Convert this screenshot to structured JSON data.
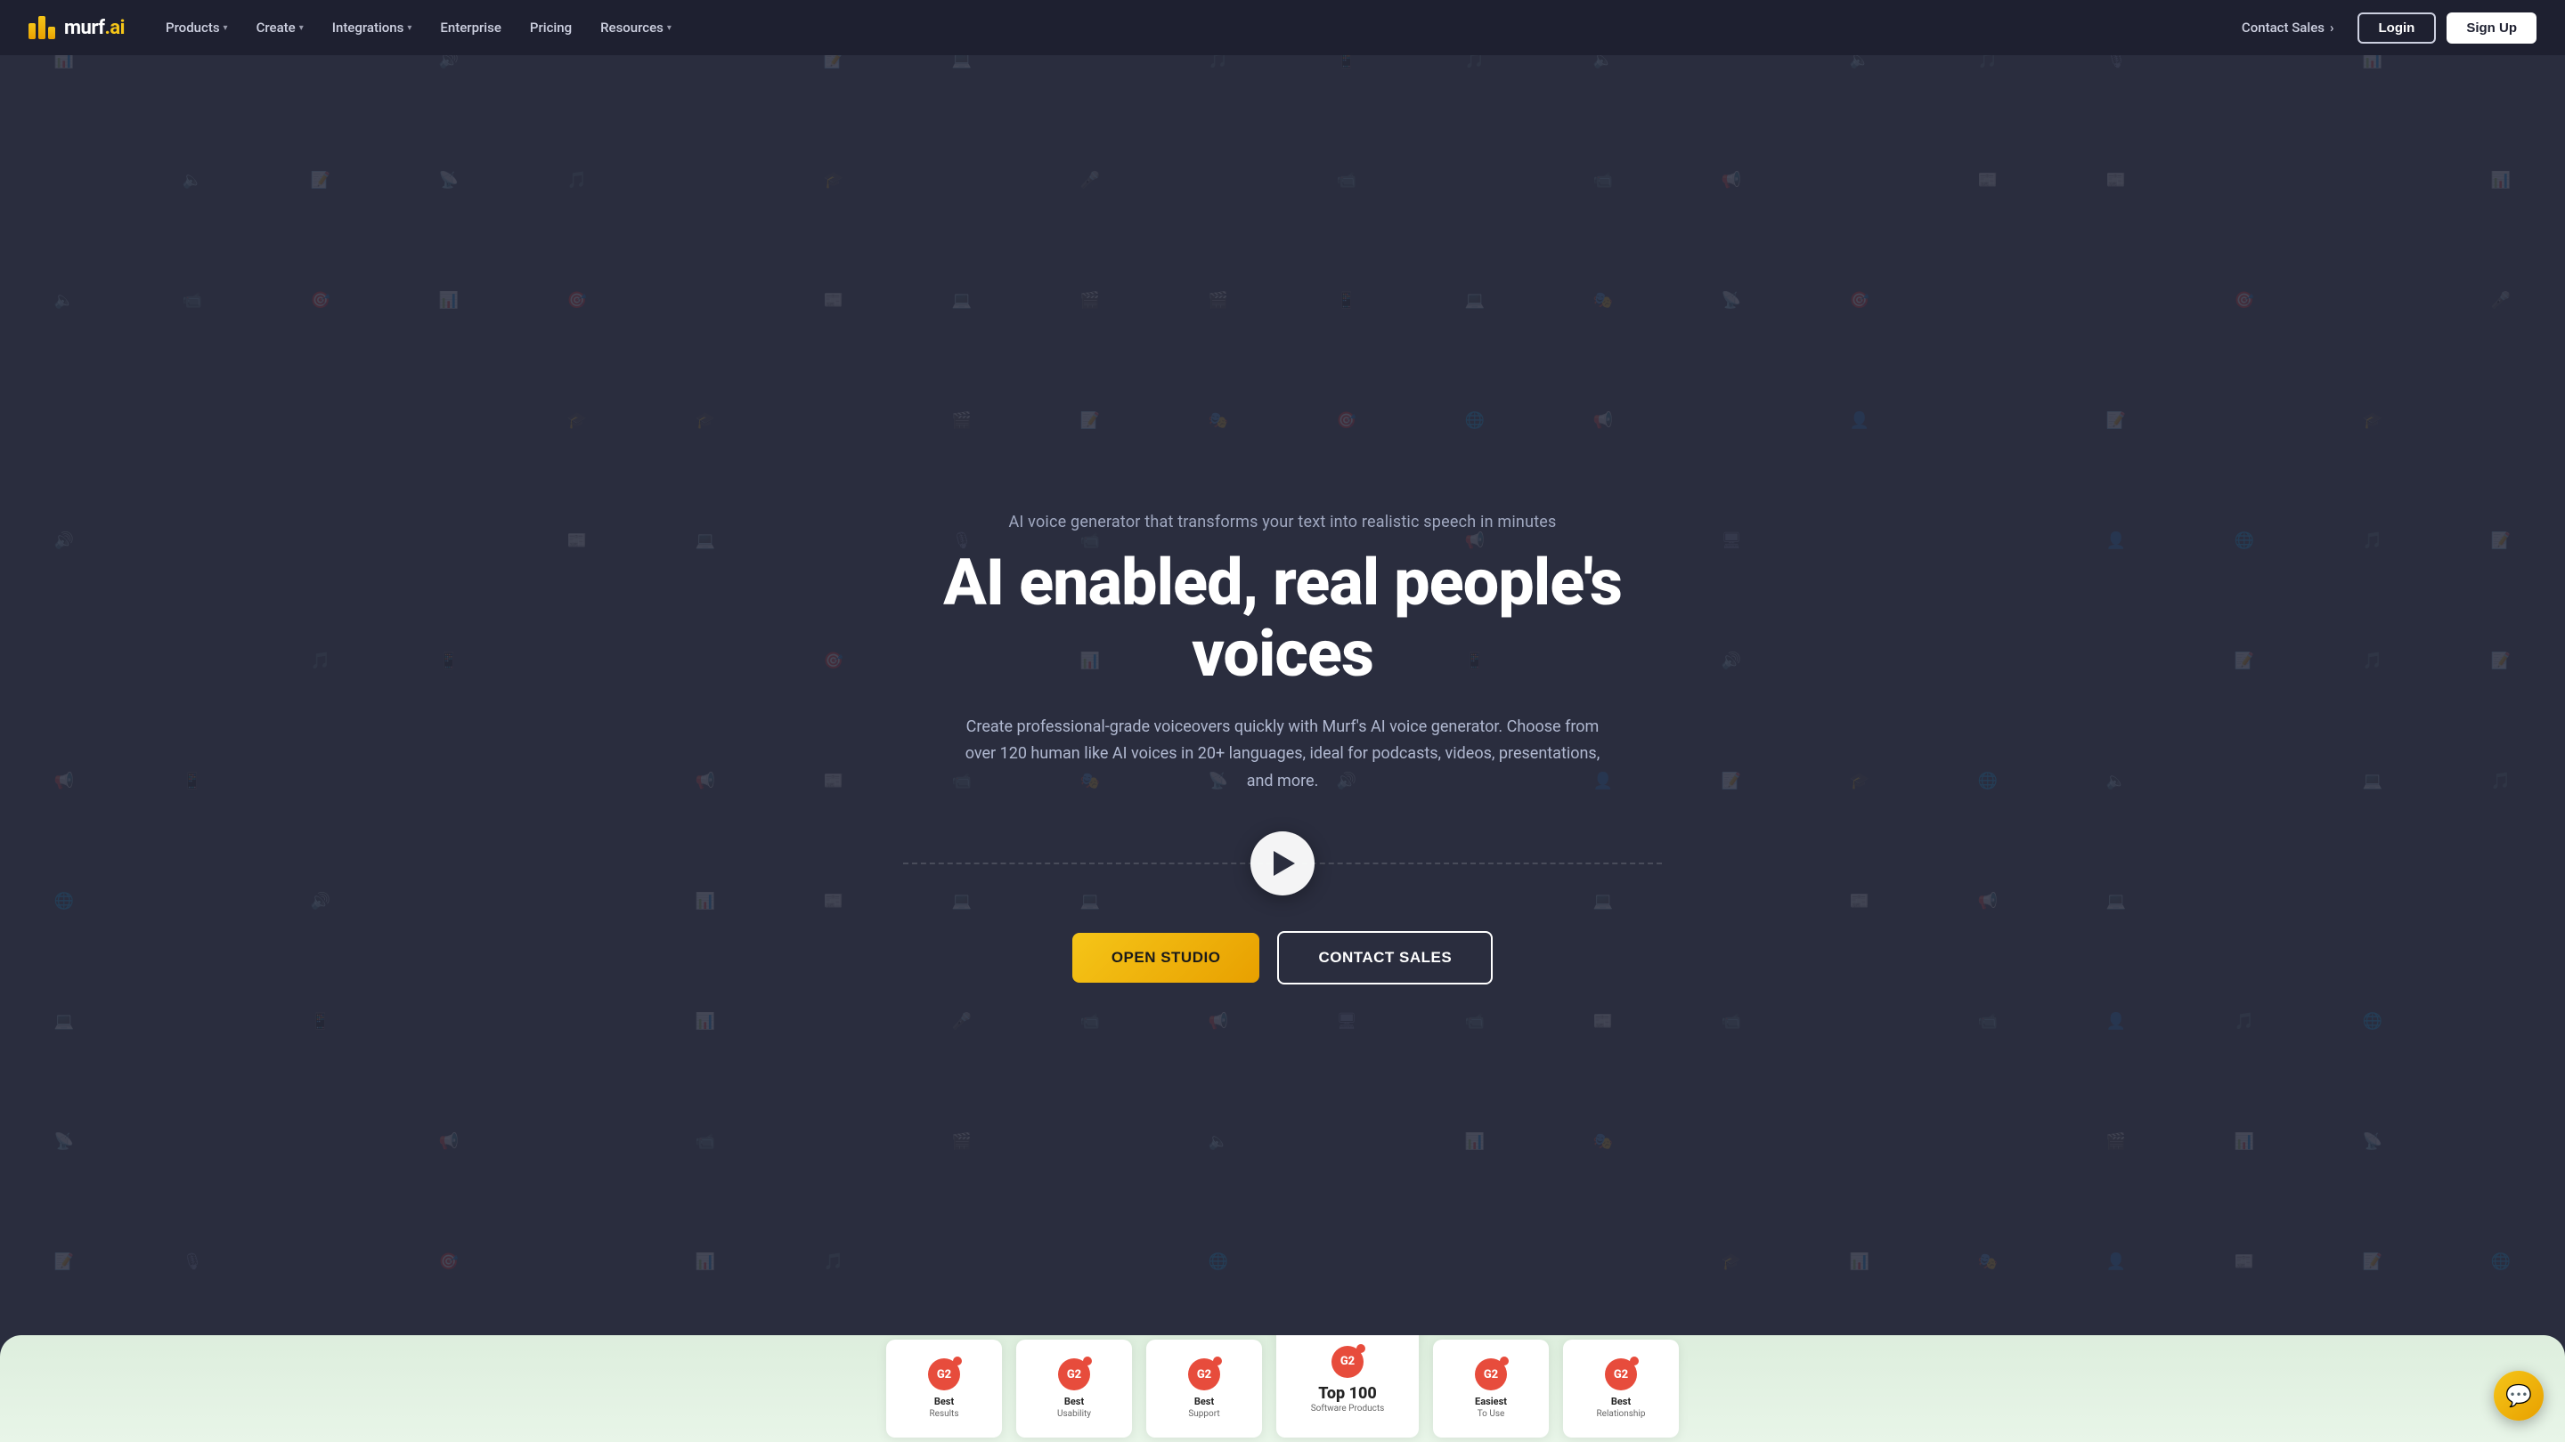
{
  "brand": {
    "name": "MURF.AI",
    "logo_text": "murf",
    "logo_suffix": ".ai"
  },
  "navbar": {
    "products_label": "Products",
    "create_label": "Create",
    "integrations_label": "Integrations",
    "enterprise_label": "Enterprise",
    "pricing_label": "Pricing",
    "resources_label": "Resources",
    "contact_sales_label": "Contact Sales",
    "login_label": "Login",
    "signup_label": "Sign Up"
  },
  "hero": {
    "subtitle": "AI voice generator that transforms your text into realistic speech in minutes",
    "title": "AI enabled, real people's voices",
    "description": "Create professional-grade voiceovers quickly with Murf's AI voice generator. Choose from over 120 human like AI voices in 20+ languages, ideal for podcasts, videos, presentations, and more.",
    "open_studio_label": "OPEN STUDIO",
    "contact_sales_label": "CONTACT SALES"
  },
  "awards": [
    {
      "badge": "G2",
      "title": "Best",
      "sub": "Results",
      "featured": false
    },
    {
      "badge": "G2",
      "title": "Best",
      "sub": "Usability",
      "featured": false
    },
    {
      "badge": "G2",
      "title": "Best",
      "sub": "Support",
      "featured": false
    },
    {
      "badge": "G2",
      "title": "Top 100",
      "sub": "Software Products",
      "featured": true
    },
    {
      "badge": "G2",
      "title": "Easiest",
      "sub": "To Use",
      "featured": false
    },
    {
      "badge": "G2",
      "title": "Best",
      "sub": "Relationship",
      "featured": false
    }
  ],
  "icons": [
    "🎙",
    "📹",
    "📊",
    "🎵",
    "🌐",
    "👤",
    "📱",
    "💻",
    "🎓",
    "📰",
    "🎭",
    "🔊",
    "📡",
    "🎬",
    "🎤",
    "📝",
    "🖥",
    "🎯",
    "📢",
    "🔈"
  ]
}
